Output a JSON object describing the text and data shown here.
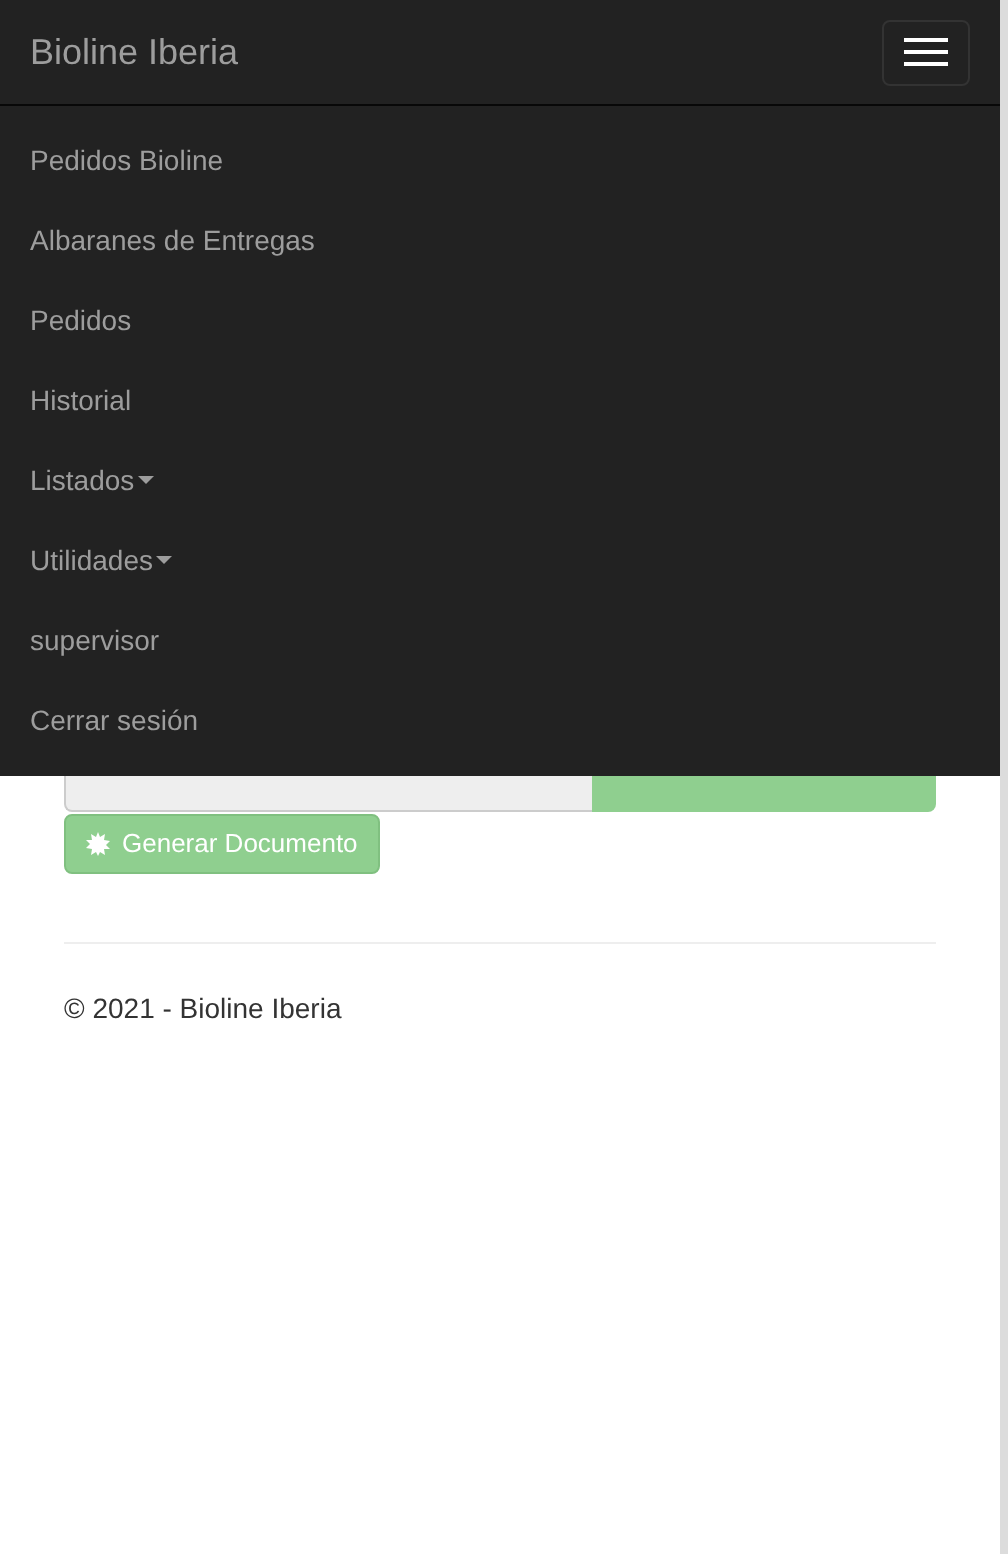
{
  "navbar": {
    "brand": "Bioline Iberia",
    "menu_items": [
      {
        "label": "Pedidos Bioline",
        "kind": "link"
      },
      {
        "label": "Albaranes de Entregas",
        "kind": "link"
      },
      {
        "label": "Pedidos",
        "kind": "link"
      },
      {
        "label": "Historial",
        "kind": "link"
      },
      {
        "label": "Listados",
        "kind": "dropdown"
      },
      {
        "label": "Utilidades",
        "kind": "dropdown"
      },
      {
        "label": "supervisor",
        "kind": "link"
      },
      {
        "label": "Cerrar sesión",
        "kind": "link"
      }
    ]
  },
  "form": {
    "generate_button": "Generar Documento"
  },
  "footer": "© 2021 - Bioline Iberia"
}
